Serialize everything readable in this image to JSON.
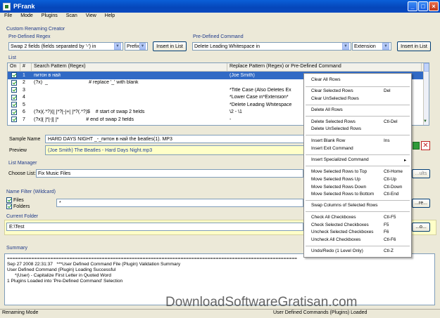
{
  "window": {
    "title": "PFrank"
  },
  "menu": [
    "File",
    "Mode",
    "Plugins",
    "Scan",
    "View",
    "Help"
  ],
  "creator": {
    "group_label": "Custom Renaming Creator",
    "regex_label": "Pre-Defined Regex",
    "regex_value": "Swap 2 fields (fields separated by '-') in",
    "prefix_value": "Prefix",
    "insert_label": "Insert in List",
    "command_label": "Pre-Defined Command",
    "command_value": "Delete Leading Whitespace in",
    "extension_value": "Extension",
    "insert2_label": "Insert in List"
  },
  "list": {
    "label": "List",
    "headers": [
      "On",
      "#",
      "Search Pattern (Regex)",
      "Replace Pattern (Regex)  or  Pre-Defined Command"
    ],
    "rows": [
      {
        "n": "1",
        "search": "питон в най",
        "replace": "(Joe Smith)"
      },
      {
        "n": "2",
        "search": "(?x)  _                              # replace '_' with blank",
        "replace": ""
      },
      {
        "n": "3",
        "search": "",
        "replace": "*Title Case (Also Deletes Ex"
      },
      {
        "n": "4",
        "search": "",
        "replace": "*Lower Case in*Extension*"
      },
      {
        "n": "5",
        "search": "",
        "replace": "*Delete Leading Whitespace"
      },
      {
        "n": "6",
        "search": "(?x)(.*?)([ ]*?[-]+[ ]*?(.*?)$    # start of swap 2 fields",
        "replace": "\\2 - \\1"
      },
      {
        "n": "7",
        "search": "(?x)[ ]*[-][ ]*                    # end of swap 2 fields",
        "replace": "-"
      }
    ]
  },
  "sample": {
    "label": "Sample Name",
    "value": "HARD DAYS NIGHT _-_питон в най                 the beatles(1).  MP3"
  },
  "preview": {
    "label": "Preview",
    "value": "(Joe Smith) The Beatles - Hard Days Night.mp3"
  },
  "list_manager": {
    "label": "List Manager",
    "choose_label": "Choose List:",
    "choose_value": "Fix Music Files",
    "side_btn": "...ults"
  },
  "name_filter": {
    "label": "Name Filter (Wildcard)",
    "files": "Files",
    "folders": "Folders",
    "value": "*",
    "btn": "...re..."
  },
  "current_folder": {
    "label": "Current Folder",
    "value": "E:\\Test",
    "btn": "...o..."
  },
  "summary": {
    "label": "Summary",
    "lines": [
      "===========================================================================================================",
      "Sep 27 2008 22:31:37   ***User Defined Command File (Plugin) Validation Summary",
      "",
      "User Defined Command (Plugin) Loading Successful",
      "      *(User) - Capitalize First Letter in Quoted Word",
      "1 Plugins Loaded into 'Pre-Defined Command' Selection"
    ]
  },
  "status": {
    "left": "Renaming Mode",
    "right": "User Defined Commands (Plugins) Loaded"
  },
  "context_menu": [
    {
      "label": "Clear All Rows",
      "shortcut": ""
    },
    {
      "label": "Clear Selected Rows",
      "shortcut": "Del"
    },
    {
      "label": "Clear UnSelected Rows",
      "shortcut": ""
    },
    {
      "label": "Delete All Rows",
      "shortcut": ""
    },
    {
      "label": "Delete Selected Rows",
      "shortcut": "Ctl-Del"
    },
    {
      "label": "Delete UnSelected Rows",
      "shortcut": ""
    },
    {
      "label": "Insert Blank Row",
      "shortcut": "Ins"
    },
    {
      "label": "Insert Exit Command",
      "shortcut": ""
    },
    {
      "label": "Insert Specialized Command",
      "shortcut": "▸"
    },
    {
      "label": "Move Selected Rows to Top",
      "shortcut": "Ctl-Home"
    },
    {
      "label": "Move Selected Rows Up",
      "shortcut": "Ctl-Up"
    },
    {
      "label": "Move Selected Rows Down",
      "shortcut": "Ctl-Down"
    },
    {
      "label": "Move Selected Rows to Bottom",
      "shortcut": "Ctl-End"
    },
    {
      "label": "Swap Columns of Selected Rows",
      "shortcut": ""
    },
    {
      "label": "Check All Checkboxes",
      "shortcut": "Ctl-F5"
    },
    {
      "label": "Check Selected Checkboxes",
      "shortcut": "F5"
    },
    {
      "label": "Uncheck Selected Checkboxes",
      "shortcut": "F6"
    },
    {
      "label": "Uncheck All Checkboxes",
      "shortcut": "Ctl-F6"
    },
    {
      "label": "Undo/Redo (1 Level Only)",
      "shortcut": "Ctl-Z"
    }
  ],
  "watermark": "DownloadSoftwareGratisan.com"
}
